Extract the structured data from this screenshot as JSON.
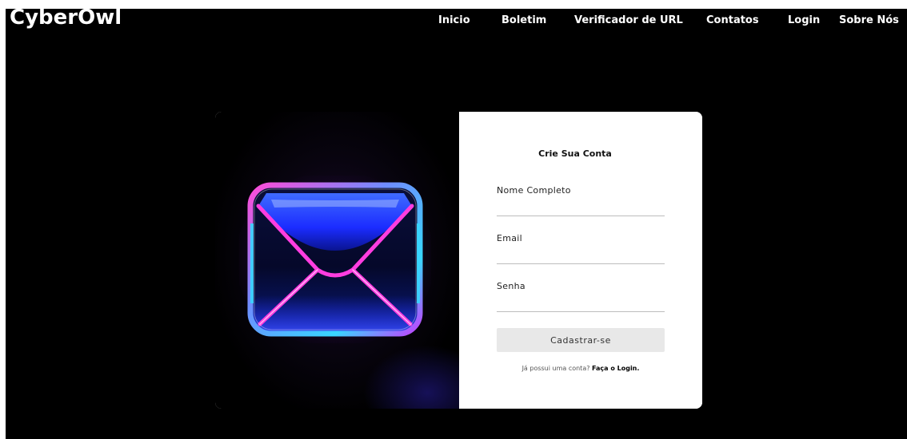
{
  "brand": {
    "name": "CyberOwl"
  },
  "nav": {
    "items": [
      "Inicio",
      "Boletim",
      "Verificador de URL",
      "Contatos",
      "Login",
      "Sobre Nós"
    ]
  },
  "signup": {
    "title": "Crie Sua Conta",
    "fields": [
      {
        "label": "Nome Completo",
        "value": "",
        "type": "text"
      },
      {
        "label": "Email",
        "value": "",
        "type": "email"
      },
      {
        "label": "Senha",
        "value": "",
        "type": "password"
      }
    ],
    "submit_label": "Cadastrar-se",
    "login_prompt": "Já possui uma conta?",
    "login_link": "Faça o Login."
  },
  "colors": {
    "page_bg": "#000000",
    "card_bg": "#ffffff",
    "button_bg": "#e8e8e8",
    "envelope_blue": "#1b2cff",
    "envelope_pink": "#ff3de0",
    "envelope_cyan": "#38d6ff"
  },
  "icons": {
    "illustration": "neon-envelope-icon"
  }
}
